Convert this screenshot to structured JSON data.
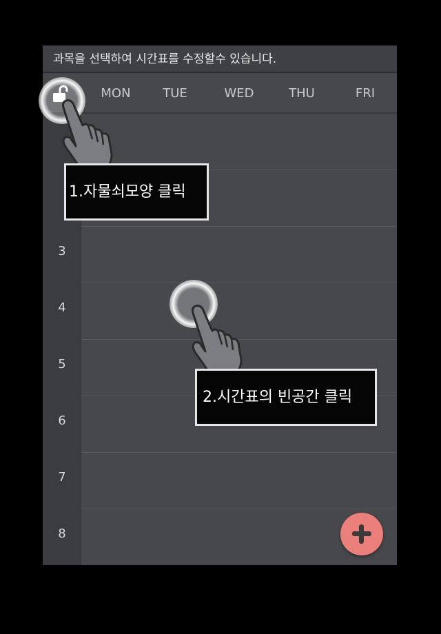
{
  "hint_text": "과목을 선택하여 시간표를 수정할수 있습니다.",
  "days": [
    "MON",
    "TUE",
    "WED",
    "THU",
    "FRI"
  ],
  "hours": [
    "3",
    "4",
    "5",
    "6",
    "7",
    "8"
  ],
  "callouts": {
    "step1": "1.자물쇠모양 클릭",
    "step2": "2.시간표의 빈공간 클릭"
  },
  "icons": {
    "lock": "unlock-icon",
    "fab": "plus-icon",
    "pointer": "hand-pointer-icon"
  },
  "colors": {
    "background": "#46484c",
    "time_column": "#3a3c40",
    "fab": "#ea7f7b",
    "callout_bg": "#050505",
    "callout_border": "#e6e6e6"
  }
}
